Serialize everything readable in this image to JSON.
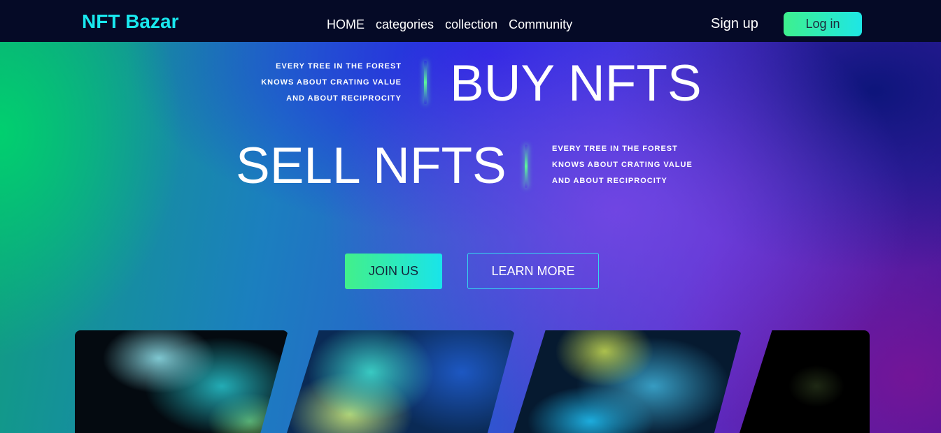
{
  "brand": {
    "name": "NFT Bazar",
    "color": "#19e8ee"
  },
  "nav": {
    "links": [
      "HOME",
      "categories",
      "collection",
      "Community"
    ],
    "signup_label": "Sign up",
    "login_label": "Log in"
  },
  "hero": {
    "block1": {
      "lines": [
        "EVERY TREE IN THE FOREST",
        "KNOWS ABOUT CRATING VALUE",
        "AND ABOUT RECIPROCITY"
      ],
      "headline": "BUY NFTS"
    },
    "block2": {
      "headline": "SELL NFTS",
      "lines": [
        "EVERY TREE IN THE FOREST",
        "KNOWS ABOUT CRATING VALUE",
        "AND ABOUT RECIPROCITY"
      ]
    },
    "join_label": "JOIN US",
    "learn_label": "LEARN MORE"
  },
  "colors": {
    "accent_start": "#42f08a",
    "accent_end": "#19e4ea",
    "navbar_bg": "#050a26"
  }
}
